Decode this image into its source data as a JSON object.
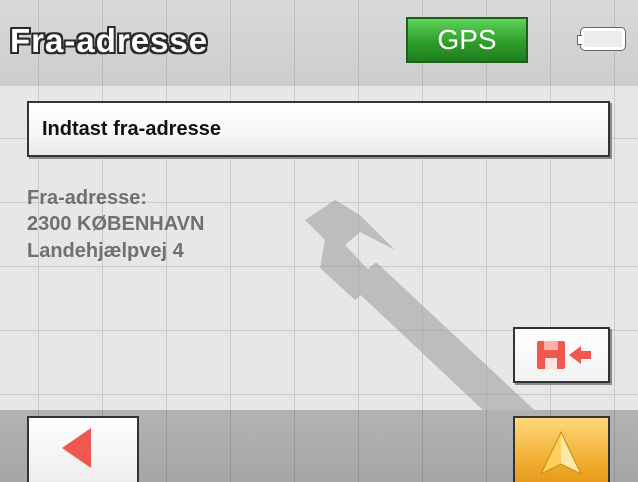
{
  "header": {
    "title": "Fra-adresse",
    "gps_label": "GPS",
    "battery_icon": "battery-icon"
  },
  "main": {
    "input_button_label": "Indtast fra-adresse",
    "address": {
      "caption": "Fra-adresse:",
      "line1": "2300 KØBENHAVN",
      "line2": "Landehjælpvej 4"
    }
  },
  "buttons": {
    "save_icon": "save-to-favorites-icon",
    "back_icon": "back-arrow-icon",
    "navigate_icon": "navigate-arrow-icon"
  },
  "colors": {
    "gps_green": "#2f9e2c",
    "back_arrow": "#f0574f",
    "save_red": "#f0574f",
    "navigate_orange": "#f2b238"
  }
}
